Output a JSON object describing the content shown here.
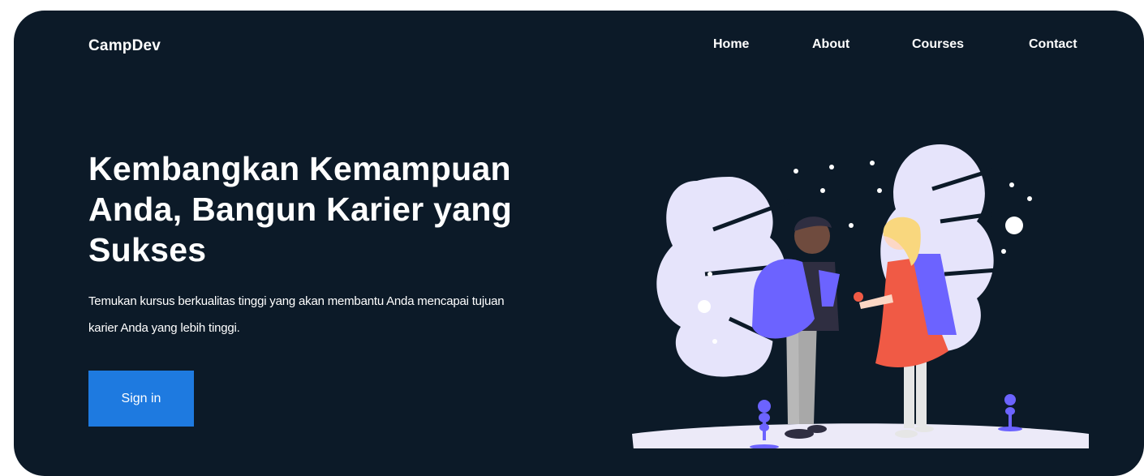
{
  "brand": {
    "name": "CampDev"
  },
  "nav": {
    "items": [
      {
        "label": "Home"
      },
      {
        "label": "About"
      },
      {
        "label": "Courses"
      },
      {
        "label": "Contact"
      }
    ]
  },
  "hero": {
    "headline": "Kembangkan Kemampuan Anda, Bangun Karier yang Sukses",
    "subtext": "Temukan kursus berkualitas tinggi yang akan membantu Anda mencapai tujuan karier Anda yang lebih tinggi.",
    "cta_label": "Sign in"
  },
  "illustration": {
    "icon": "kids-with-backpacks-illustration"
  },
  "colors": {
    "background": "#0c1a28",
    "accent": "#1e7ae0",
    "illustration_purple": "#6c63ff",
    "illustration_lavender": "#e6e4fb",
    "illustration_red": "#f05a45"
  }
}
